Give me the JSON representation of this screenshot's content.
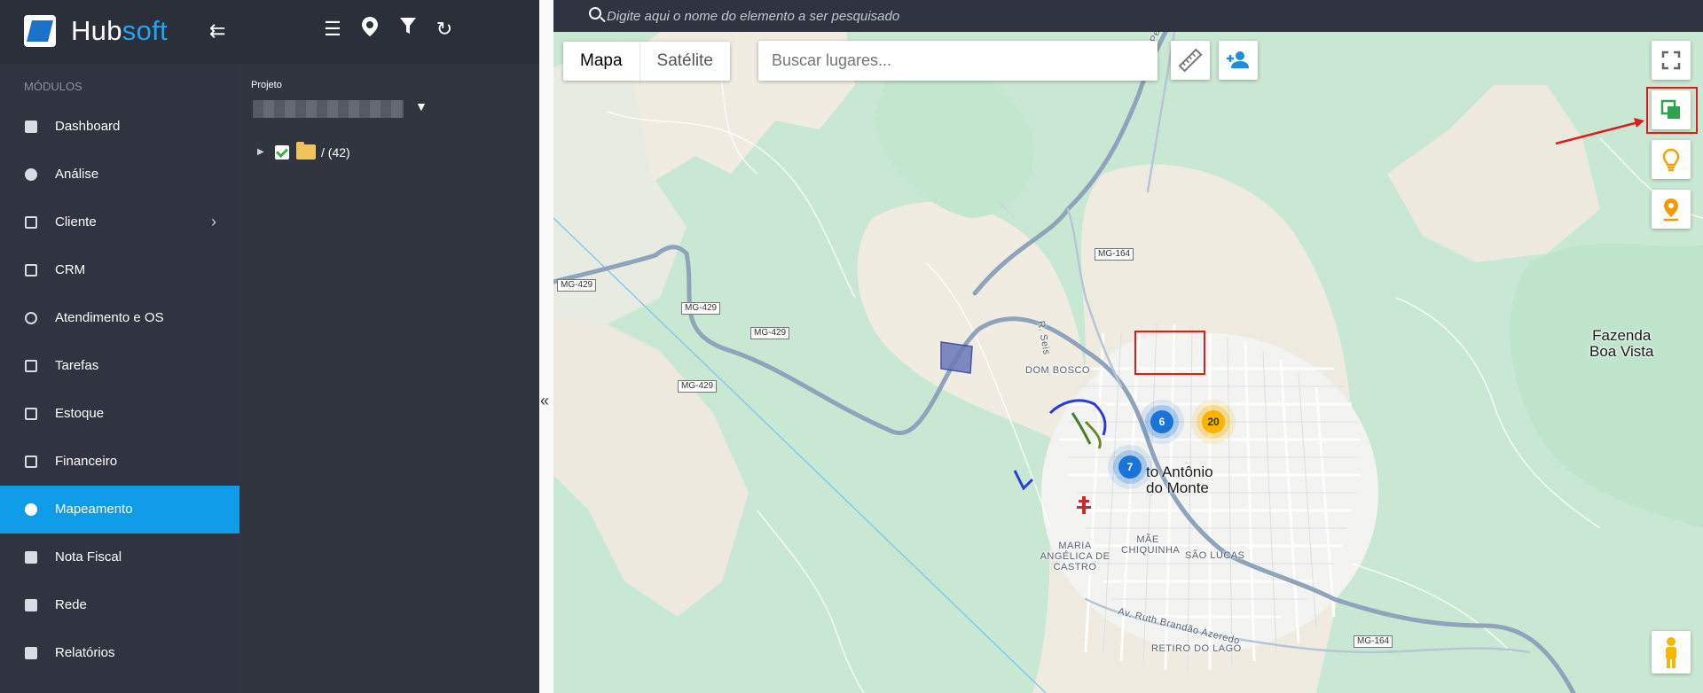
{
  "sidebar": {
    "brand_left": "Hub",
    "brand_right": "soft",
    "collapse_icon": "collapse-menu-icon",
    "section_title": "MÓDULOS",
    "items": [
      {
        "label": "Dashboard",
        "icon": "dashboard-icon"
      },
      {
        "label": "Análise",
        "icon": "pie-chart-icon"
      },
      {
        "label": "Cliente",
        "icon": "contact-card-icon",
        "has_submenu": true
      },
      {
        "label": "CRM",
        "icon": "kanban-icon"
      },
      {
        "label": "Atendimento e OS",
        "icon": "clock-history-icon"
      },
      {
        "label": "Tarefas",
        "icon": "tasks-icon"
      },
      {
        "label": "Estoque",
        "icon": "box-icon"
      },
      {
        "label": "Financeiro",
        "icon": "money-icon"
      },
      {
        "label": "Mapeamento",
        "icon": "map-pin-icon",
        "active": true
      },
      {
        "label": "Nota Fiscal",
        "icon": "invoice-icon"
      },
      {
        "label": "Rede",
        "icon": "server-icon"
      },
      {
        "label": "Relatórios",
        "icon": "report-icon"
      }
    ],
    "active_color": "#0e9be8"
  },
  "panel": {
    "toolbar_icons": [
      "menu-icon",
      "map-marker-icon",
      "filter-icon",
      "refresh-icon"
    ],
    "project_label": "Projeto",
    "tree_item_text": "/ (42)"
  },
  "topbar": {
    "search_placeholder": "Digite aqui o nome do elemento a ser pesquisado"
  },
  "map": {
    "type_map": "Mapa",
    "type_satellite": "Satélite",
    "places_placeholder": "Buscar lugares...",
    "road_shields": [
      "MG-429",
      "MG-429",
      "MG-429",
      "MG-429",
      "MG-164",
      "MG-164"
    ],
    "place_labels": [
      "DOM BOSCO",
      "MARIA ANGÉLICA DE CASTRO",
      "MÃE CHIQUINHA",
      "SÃO LUCAS",
      "RETIRO DO LAGO"
    ],
    "city_label_line1": "to Antônio",
    "city_label_line2": "do Monte",
    "farm_label_line1": "Fazenda",
    "farm_label_line2": "Boa Vista",
    "street_labels": [
      "R. Seis",
      "Av. Ruth Brandão Azeredo",
      "Rio Pena"
    ],
    "clusters": [
      {
        "count": "6",
        "color": "blue"
      },
      {
        "count": "20",
        "color": "yellow"
      },
      {
        "count": "7",
        "color": "blue"
      }
    ]
  }
}
